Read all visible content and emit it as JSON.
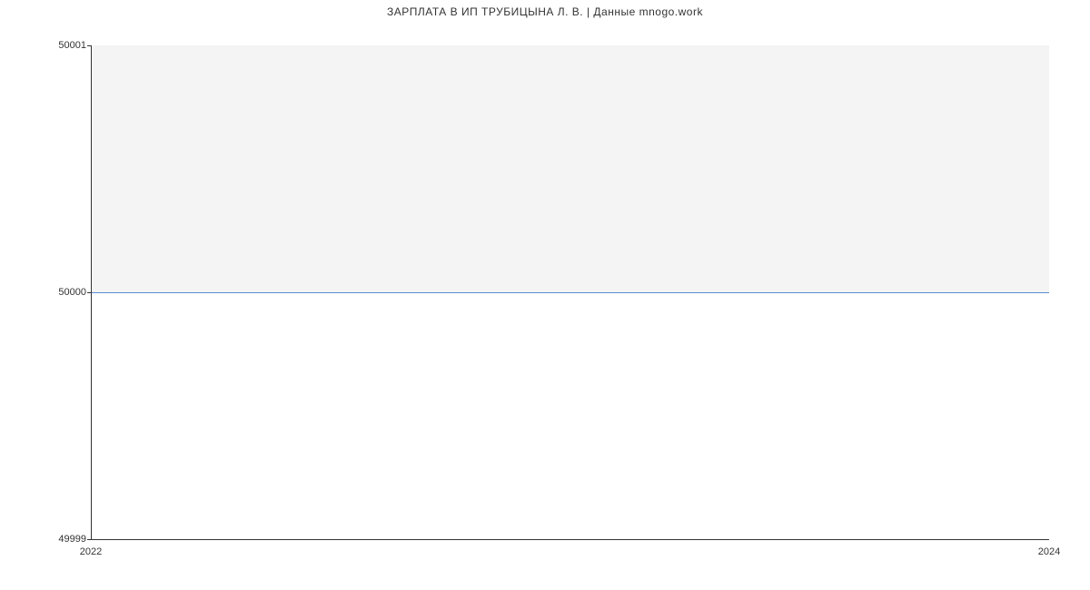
{
  "chart_data": {
    "type": "line",
    "title": "ЗАРПЛАТА В ИП ТРУБИЦЫНА Л. В. | Данные mnogo.work",
    "xlabel": "",
    "ylabel": "",
    "x": [
      2022,
      2024
    ],
    "values": [
      50000,
      50000
    ],
    "xlim": [
      2022,
      2024
    ],
    "ylim": [
      49999,
      50001
    ],
    "y_ticks": [
      49999,
      50000,
      50001
    ],
    "x_ticks": [
      2022,
      2024
    ],
    "line_color": "#5b8bd4"
  }
}
